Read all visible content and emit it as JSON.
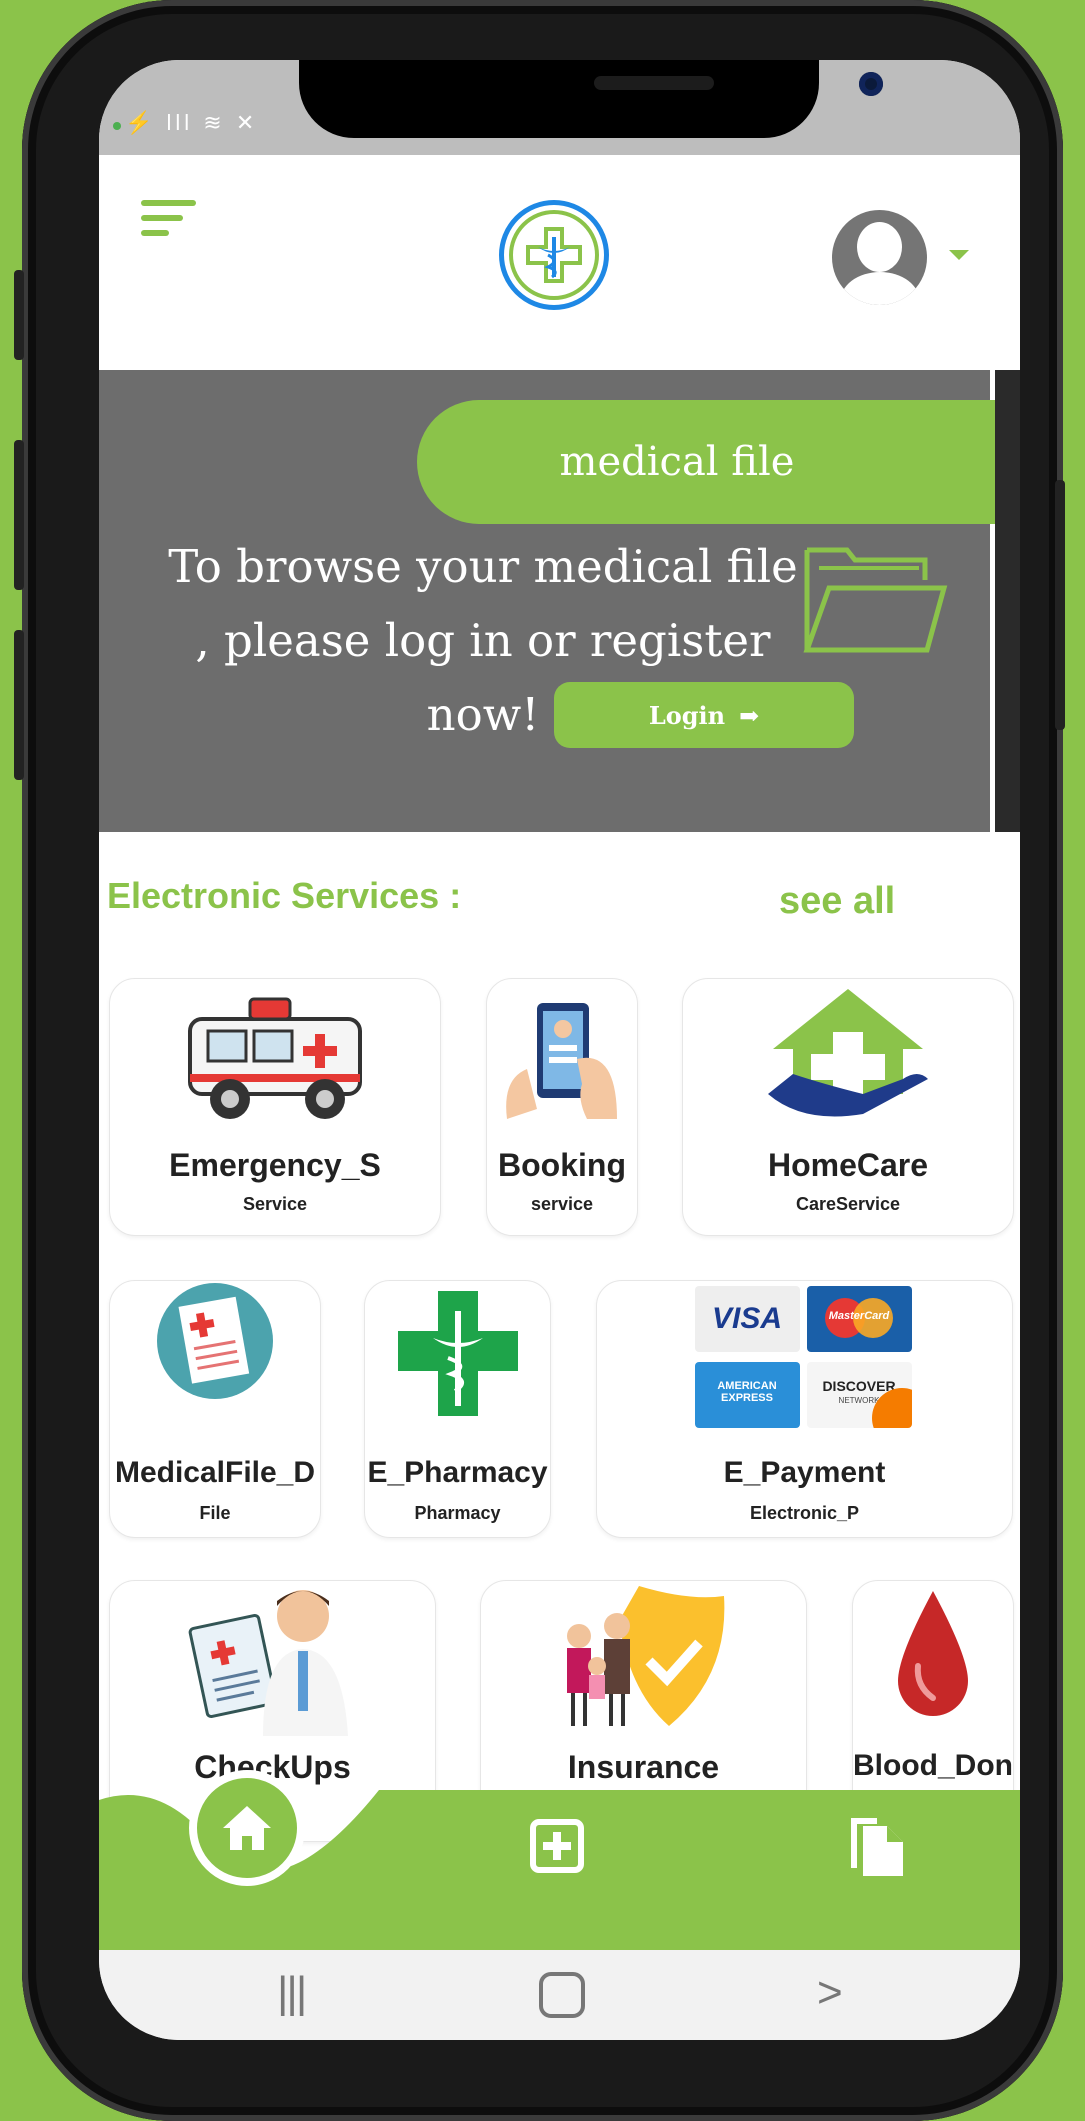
{
  "header": {
    "menu_icon": "hamburger-menu-icon",
    "logo_icon": "medical-caduceus-cross-logo",
    "avatar_icon": "user-avatar-icon"
  },
  "banner": {
    "tab_label": "medical file",
    "message_line1": "To browse your medical file",
    "message_line2": ", please log in or register now!",
    "login_label": "Login",
    "folder_icon": "folder-icon"
  },
  "services": {
    "title": "Electronic Services :",
    "see_all": "see all",
    "items": [
      {
        "name": "Emergency_S",
        "sub": "Service",
        "icon": "ambulance-icon"
      },
      {
        "name": "Booking",
        "sub": "service",
        "icon": "phone-booking-icon"
      },
      {
        "name": "HomeCare",
        "sub": "CareService",
        "icon": "home-care-icon"
      },
      {
        "name": "MedicalFile_D",
        "sub": "File",
        "icon": "medical-file-icon"
      },
      {
        "name": "E_Pharmacy",
        "sub": "Pharmacy",
        "icon": "pharmacy-cross-icon"
      },
      {
        "name": "E_Payment",
        "sub": "Electronic_P",
        "icon": "payment-cards-icon"
      },
      {
        "name": "CheckUps",
        "sub": "",
        "icon": "doctor-checkup-icon"
      },
      {
        "name": "Insurance",
        "sub": "",
        "icon": "family-insurance-icon"
      },
      {
        "name": "Blood_Don",
        "sub": "",
        "icon": "blood-drop-icon"
      }
    ]
  },
  "payment_cards": [
    "VISA",
    "MasterCard",
    "AMERICAN EXPRESS",
    "DISCOVER"
  ],
  "payment_card_sub": "NETWORK",
  "bottom_nav": {
    "home_icon": "home-icon",
    "add_icon": "add-box-icon",
    "docs_icon": "documents-icon"
  },
  "system_nav": {
    "recents": "|||",
    "home": "○",
    "back": ">"
  },
  "colors": {
    "accent": "#8bc34a",
    "banner_bg": "#6d6d6d",
    "blue": "#1e88e5"
  }
}
